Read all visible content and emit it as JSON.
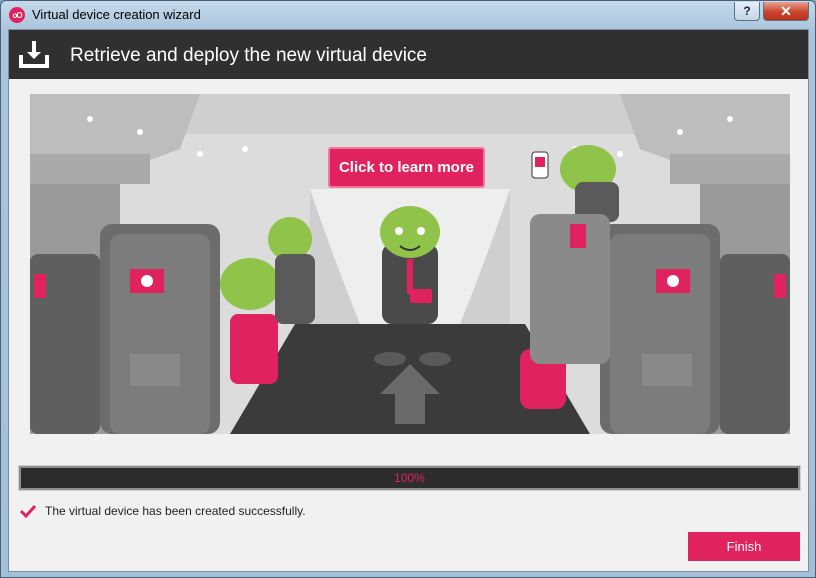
{
  "window": {
    "title": "Virtual device creation wizard",
    "help_label": "?",
    "close_label": "✕",
    "icon_text": "oO"
  },
  "header": {
    "title": "Retrieve and deploy the new virtual device",
    "icon": "download-tray-icon"
  },
  "illustration": {
    "cta_label": "Click to learn more",
    "accent_color": "#e0225f"
  },
  "progress": {
    "value": 100,
    "label": "100%"
  },
  "status": {
    "icon": "checkmark-icon",
    "message": "The virtual device has been created successfully."
  },
  "actions": {
    "finish_label": "Finish"
  },
  "colors": {
    "accent": "#e0225f",
    "header_bg": "#303030",
    "android_green": "#8fc34a"
  }
}
